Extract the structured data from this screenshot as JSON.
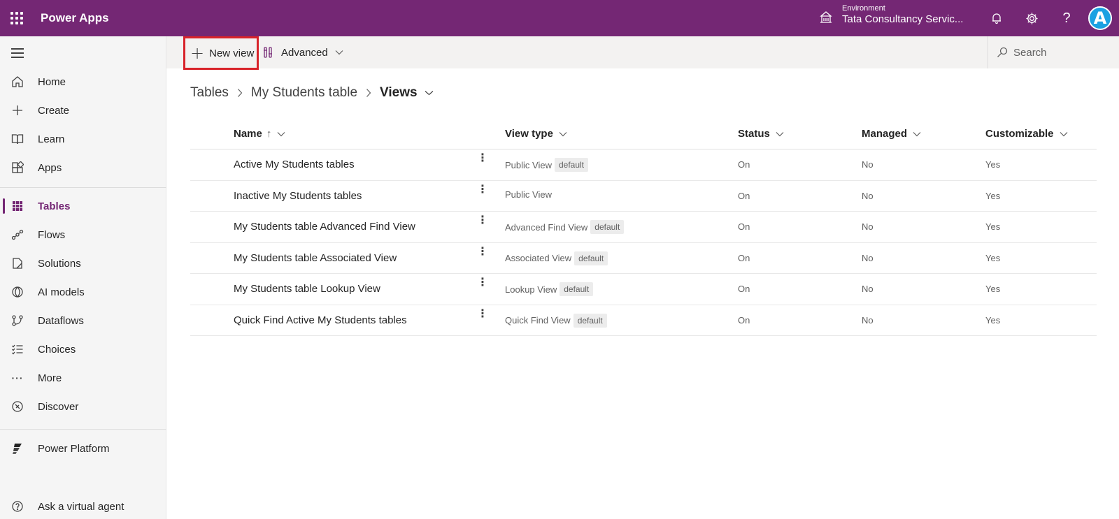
{
  "app": {
    "title": "Power Apps"
  },
  "environment": {
    "label": "Environment",
    "name": "Tata Consultancy Servic..."
  },
  "avatar": {
    "initial": "A"
  },
  "sidebar": {
    "items": [
      {
        "label": "Home",
        "icon": "home-icon"
      },
      {
        "label": "Create",
        "icon": "plus-icon"
      },
      {
        "label": "Learn",
        "icon": "book-icon"
      },
      {
        "label": "Apps",
        "icon": "apps-icon"
      },
      {
        "label": "Tables",
        "icon": "table-icon",
        "active": true
      },
      {
        "label": "Flows",
        "icon": "flow-icon"
      },
      {
        "label": "Solutions",
        "icon": "solutions-icon"
      },
      {
        "label": "AI models",
        "icon": "ai-models-icon"
      },
      {
        "label": "Dataflows",
        "icon": "dataflows-icon"
      },
      {
        "label": "Choices",
        "icon": "choices-icon"
      },
      {
        "label": "More",
        "icon": "more-icon"
      },
      {
        "label": "Discover",
        "icon": "discover-icon"
      },
      {
        "label": "Power Platform",
        "icon": "power-platform-icon"
      },
      {
        "label": "Ask a virtual agent",
        "icon": "virtual-agent-icon"
      }
    ]
  },
  "command_bar": {
    "new_view_label": "New view",
    "advanced_label": "Advanced",
    "search_placeholder": "Search"
  },
  "breadcrumb": {
    "tables": "Tables",
    "table_name": "My Students table",
    "current": "Views"
  },
  "table": {
    "columns": {
      "name": "Name",
      "view_type": "View type",
      "status": "Status",
      "managed": "Managed",
      "customizable": "Customizable"
    },
    "rows": [
      {
        "name": "Active My Students tables",
        "view_type": "Public View",
        "badge": "default",
        "status": "On",
        "managed": "No",
        "customizable": "Yes"
      },
      {
        "name": "Inactive My Students tables",
        "view_type": "Public View",
        "badge": "",
        "status": "On",
        "managed": "No",
        "customizable": "Yes"
      },
      {
        "name": "My Students table Advanced Find View",
        "view_type": "Advanced Find View",
        "badge": "default",
        "status": "On",
        "managed": "No",
        "customizable": "Yes"
      },
      {
        "name": "My Students table Associated View",
        "view_type": "Associated View",
        "badge": "default",
        "status": "On",
        "managed": "No",
        "customizable": "Yes"
      },
      {
        "name": "My Students table Lookup View",
        "view_type": "Lookup View",
        "badge": "default",
        "status": "On",
        "managed": "No",
        "customizable": "Yes"
      },
      {
        "name": "Quick Find Active My Students tables",
        "view_type": "Quick Find View",
        "badge": "default",
        "status": "On",
        "managed": "No",
        "customizable": "Yes"
      }
    ]
  },
  "colors": {
    "brand": "#742774",
    "highlight": "#d8232a",
    "avatar": "#1ba1e2"
  }
}
